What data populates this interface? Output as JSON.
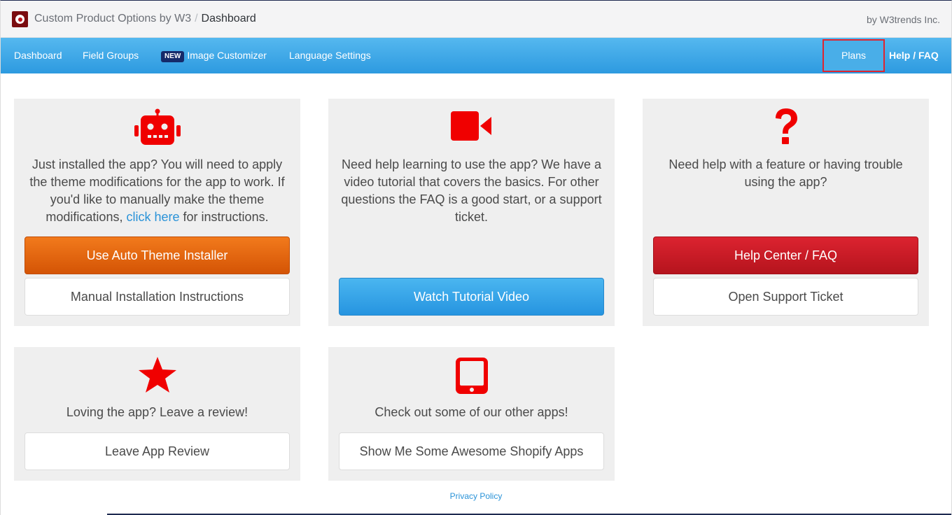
{
  "header": {
    "app_name": "Custom Product Options by W3",
    "separator": "/",
    "current_page": "Dashboard",
    "byline": "by W3trends Inc."
  },
  "nav": {
    "dashboard": "Dashboard",
    "field_groups": "Field Groups",
    "new_badge": "NEW",
    "image_customizer": "Image Customizer",
    "language_settings": "Language Settings",
    "plans": "Plans",
    "help_faq": "Help / FAQ"
  },
  "cards": {
    "install": {
      "icon": "robot-icon",
      "text_before": "Just installed the app? You will need to apply the theme modifications for the app to work. If you'd like to manually make the theme modifications,",
      "link": "click here",
      "text_after": "for instructions.",
      "primary_button": "Use Auto Theme Installer",
      "secondary_button": "Manual Installation Instructions"
    },
    "tutorial": {
      "icon": "video-camera-icon",
      "text": "Need help learning to use the app? We have a video tutorial that covers the basics. For other questions the FAQ is a good start, or a support ticket.",
      "button": "Watch Tutorial Video"
    },
    "help": {
      "icon": "question-mark-icon",
      "text": "Need help with a feature or having trouble using the app?",
      "primary_button": "Help Center / FAQ",
      "secondary_button": "Open Support Ticket"
    },
    "review": {
      "icon": "star-icon",
      "text": "Loving the app? Leave a review!",
      "button": "Leave App Review"
    },
    "apps": {
      "icon": "tablet-icon",
      "text": "Check out some of our other apps!",
      "button": "Show Me Some Awesome Shopify Apps"
    }
  },
  "footer": {
    "privacy": "Privacy Policy"
  },
  "colors": {
    "nav_blue": "#2d9ae0",
    "icon_red": "#f00000",
    "orange": "#e8650f",
    "link_blue": "#2a93d8"
  }
}
